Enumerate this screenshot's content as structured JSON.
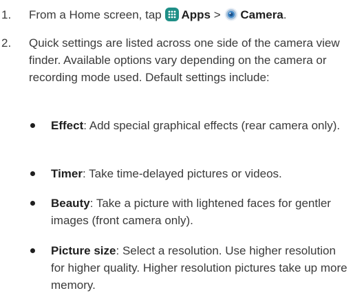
{
  "steps": [
    {
      "number": "1.",
      "prefix": "From a Home screen, tap",
      "apps_label": "Apps",
      "separator": ">",
      "camera_label": "Camera",
      "suffix": ".",
      "icons": [
        "apps-icon",
        "camera-icon"
      ]
    },
    {
      "number": "2.",
      "text": "Quick settings are listed across one side of the camera view finder. Available options vary depending on the camera or recording mode used. Default settings include:"
    }
  ],
  "bullets": [
    {
      "term": "Effect",
      "desc": ": Add special graphical effects (rear camera only)."
    },
    {
      "term": "Timer",
      "desc": ": Take time-delayed pictures or videos."
    },
    {
      "term": "Beauty",
      "desc": ": Take a picture with lightened faces for gentler images (front camera only)."
    },
    {
      "term": "Picture size",
      "desc": ": Select a resolution. Use higher resolution for higher quality. Higher resolution pictures take up more memory."
    }
  ],
  "colors": {
    "apps_icon": "#1f8f87",
    "camera_ring": "#a9c3dc",
    "camera_lens": "#3f87c7"
  }
}
